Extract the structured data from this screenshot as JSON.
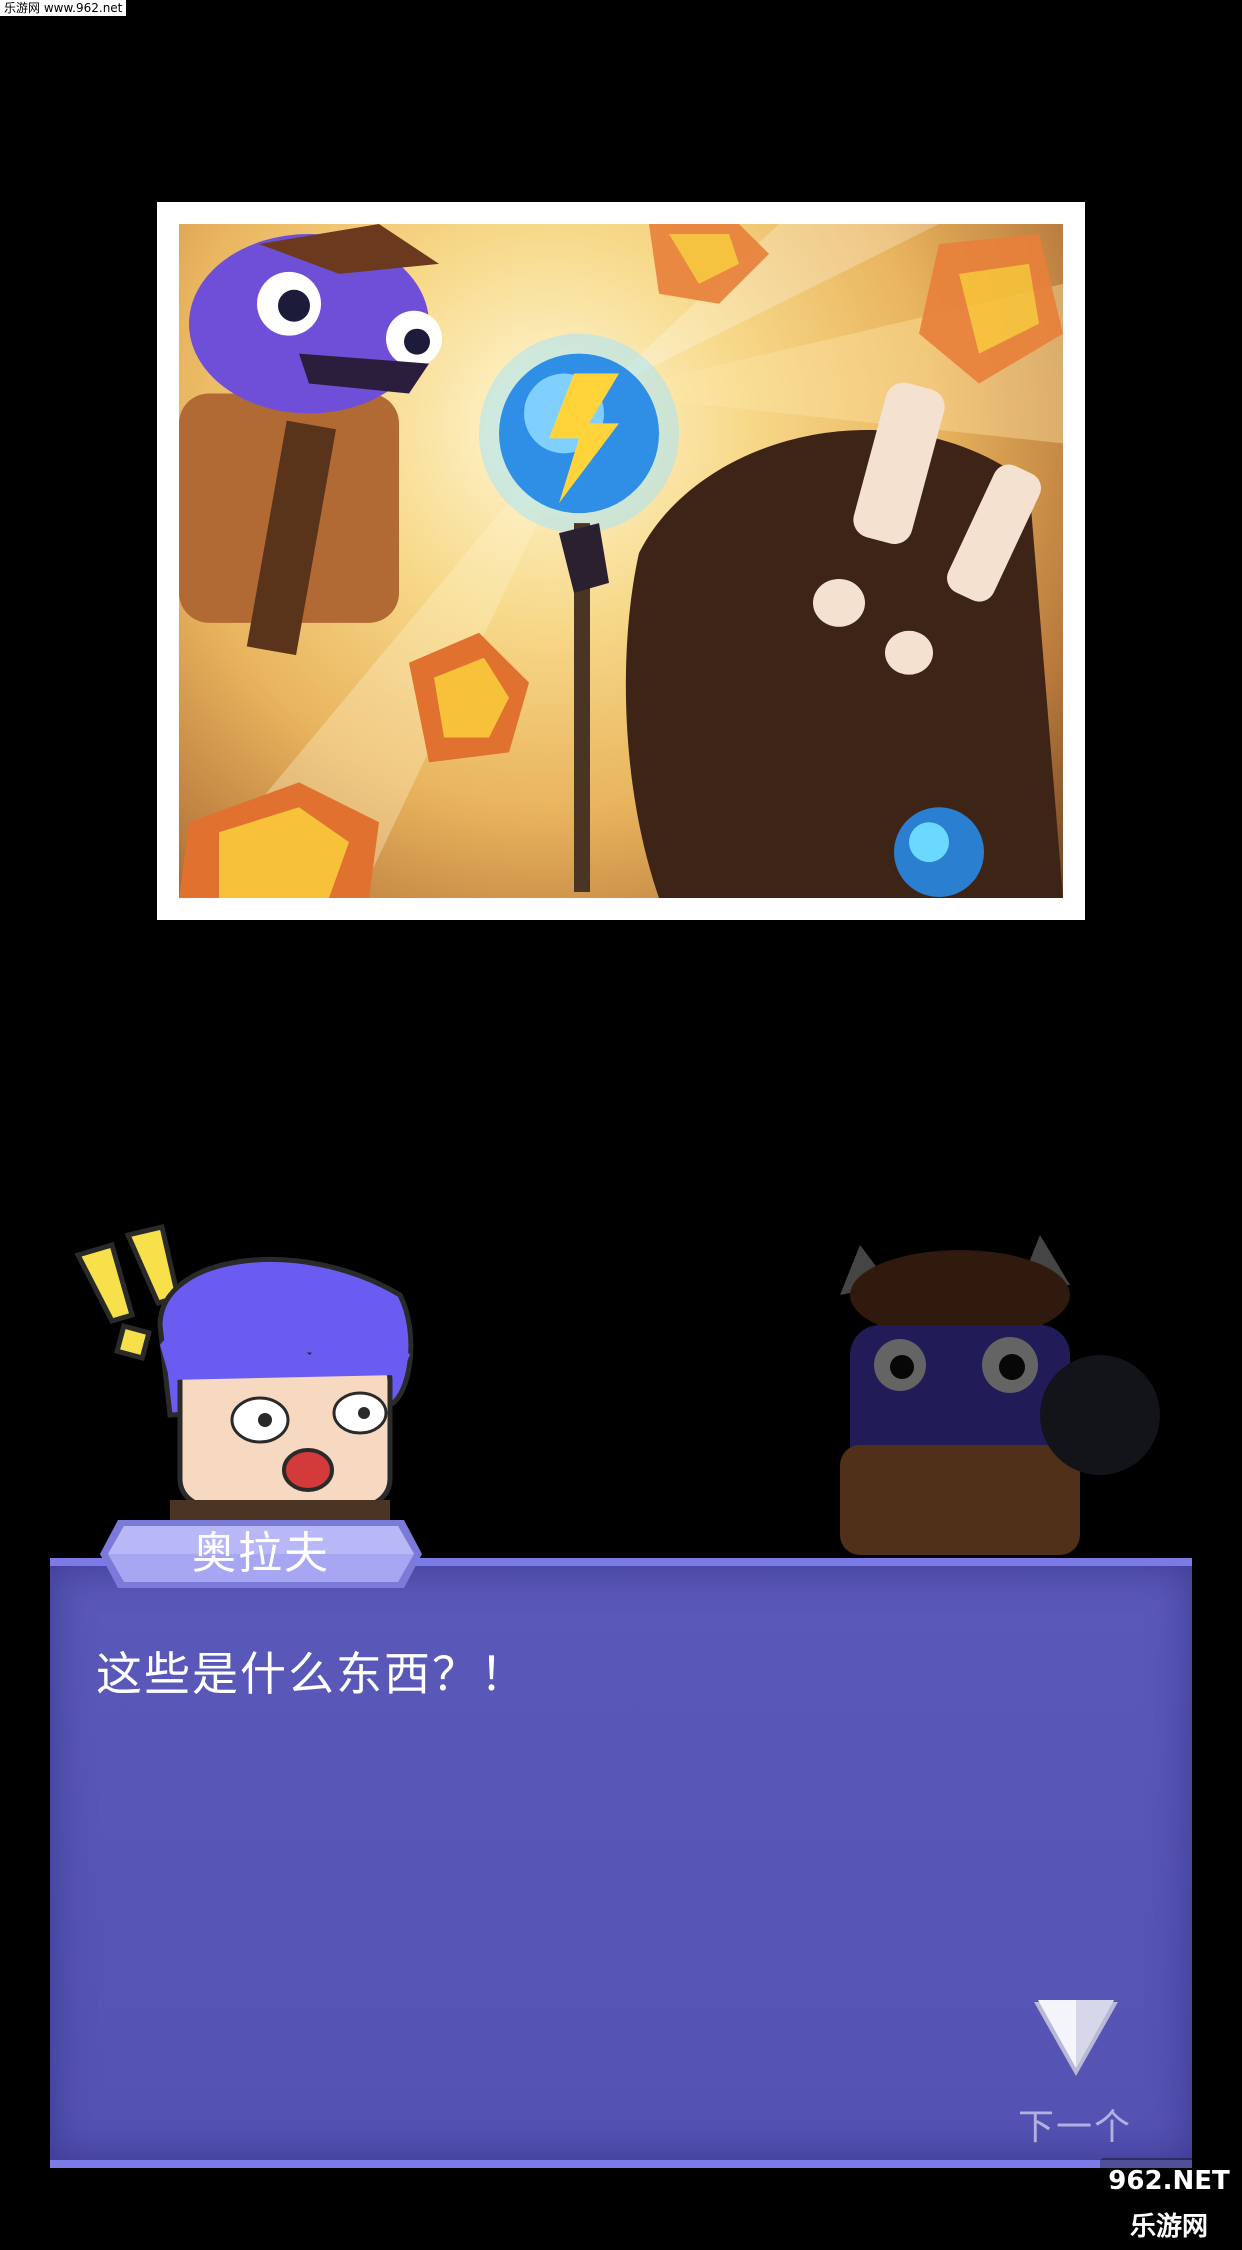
{
  "watermark_top": "乐游网 www.962.net",
  "dialog": {
    "speaker": "奥拉夫",
    "text": "这些是什么东西？！",
    "next_label": "下一个"
  },
  "watermark_bottom": "962.NET 乐游网",
  "colors": {
    "dialog_bg": "#5452b2",
    "dialog_border": "#7b7ae6",
    "nameplate": "#a6a6f2"
  }
}
